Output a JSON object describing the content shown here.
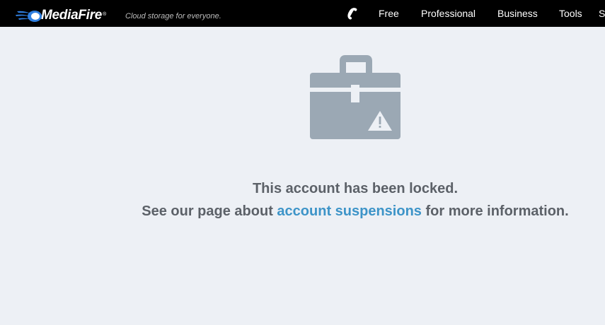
{
  "brand": {
    "name": "MediaFire",
    "registered": "®",
    "tagline": "Cloud storage for everyone."
  },
  "nav": {
    "phone_icon": "phone-icon",
    "items": [
      "Free",
      "Professional",
      "Business",
      "Tools"
    ],
    "more": "S"
  },
  "main": {
    "icon": "locked-briefcase-warning-icon",
    "locked_message": "This account has been locked.",
    "info_prefix": "See our page about ",
    "info_link": "account suspensions",
    "info_suffix": " for more information."
  },
  "colors": {
    "header_bg": "#000000",
    "page_bg": "#edf0f5",
    "icon_gray": "#9ba8b4",
    "text_gray": "#5c6168",
    "link_blue": "#3d94c8"
  }
}
